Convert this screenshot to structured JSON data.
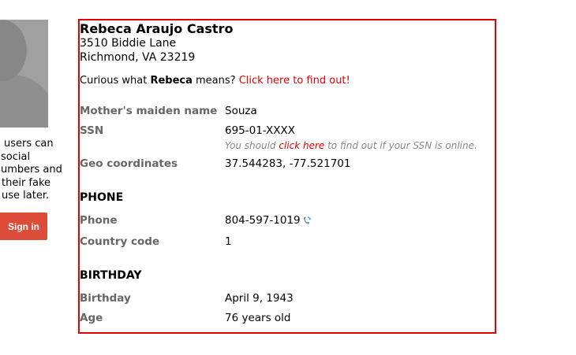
{
  "sidebar": {
    "text_lines": [
      "users can",
      "social",
      "umbers and",
      "their fake",
      "use later."
    ],
    "signin_label": "Sign in",
    "signin_color": "#dd4b39"
  },
  "profile": {
    "name": "Rebeca Araujo Castro",
    "address_line1": "3510 Biddie Lane",
    "address_line2": "Richmond, VA 23219",
    "curious_prefix": "Curious what ",
    "curious_name": "Rebeca",
    "curious_suffix": " means? ",
    "curious_link": "Click here to find out!",
    "fields": {
      "maiden_label": "Mother's maiden name",
      "maiden_value": "Souza",
      "ssn_label": "SSN",
      "ssn_value": "695-01-XXXX",
      "ssn_note_prefix": "You should ",
      "ssn_note_link": "click here",
      "ssn_note_suffix": " to find out if your SSN is online.",
      "geo_label": "Geo coordinates",
      "geo_value": "37.544283, -77.521701"
    },
    "phone_section": {
      "heading": "PHONE",
      "phone_label": "Phone",
      "phone_value": "804-597-1019",
      "country_label": "Country code",
      "country_value": "1"
    },
    "birthday_section": {
      "heading": "BIRTHDAY",
      "birthday_label": "Birthday",
      "birthday_value": "April 9, 1943",
      "age_label": "Age",
      "age_value": "76 years old"
    }
  },
  "colors": {
    "accent_red": "#e00000",
    "label_gray": "#666666"
  },
  "icons": {
    "phone_icon": "phone-refresh-icon"
  }
}
